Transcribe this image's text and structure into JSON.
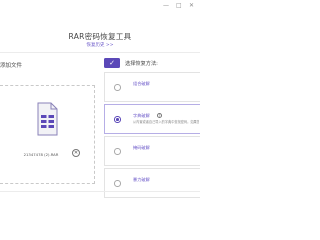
{
  "window": {
    "minimize_glyph": "—",
    "maximize_glyph": "□",
    "close_glyph": "✕"
  },
  "header": {
    "title": "RAR密码恢复工具",
    "history_link": "恢复历史 >>"
  },
  "left_panel": {
    "label": "添加文件",
    "file_name": "21347478 (2).RAR",
    "remove_glyph": "✕"
  },
  "methods": {
    "header_title": "选择恢复方法:",
    "check_glyph": "✓",
    "items": [
      {
        "label": "组合破解",
        "desc": "",
        "selected": false
      },
      {
        "label": "字典破解",
        "desc": "从内置或者自己导入的字典中查找密码。如果您记得密码",
        "selected": true,
        "help_glyph": "?"
      },
      {
        "label": "掩码破解",
        "desc": "",
        "selected": false
      },
      {
        "label": "暴力破解",
        "desc": "",
        "selected": false
      }
    ]
  },
  "colors": {
    "accent": "#5b48b8",
    "link": "#6b58c9"
  }
}
